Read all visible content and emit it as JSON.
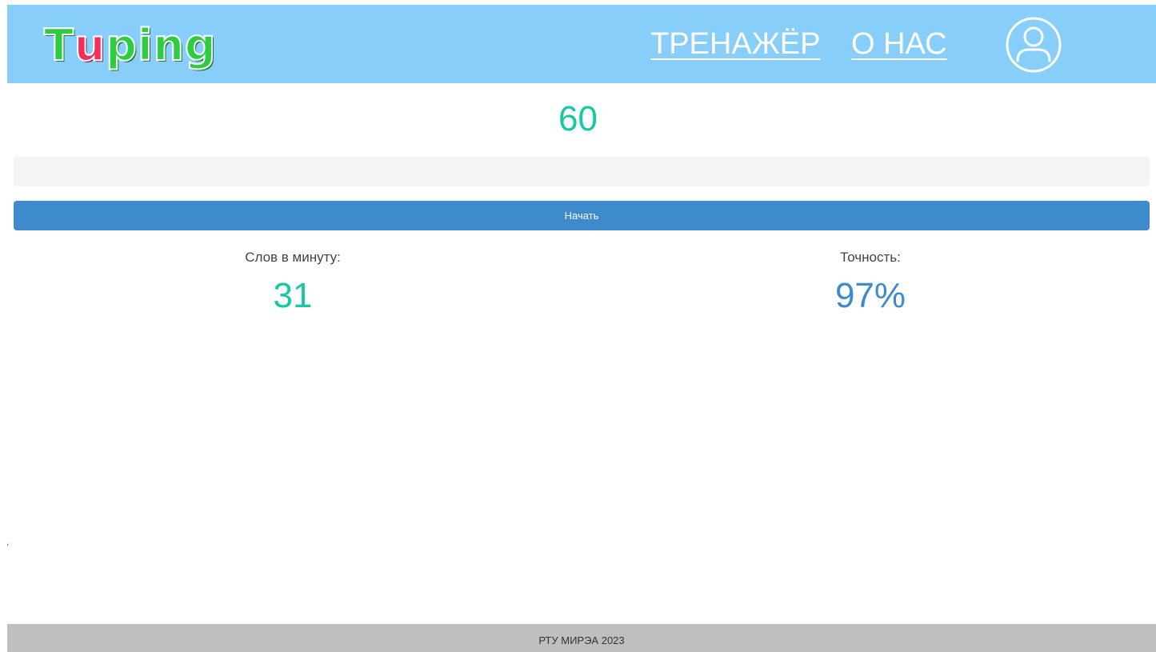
{
  "header": {
    "logo": {
      "part1": "T",
      "part2": "u",
      "part3": "ping"
    },
    "nav": {
      "trainer_label": "ТРЕНАЖЁР",
      "about_label": "О НАС"
    },
    "profile_icon": "user-circle-icon"
  },
  "main": {
    "timer": "60",
    "input": {
      "value": "",
      "placeholder": ""
    },
    "start_label": "Начать",
    "stats": {
      "wpm_label": "Слов в минуту:",
      "wpm_value": "31",
      "accuracy_label": "Точность:",
      "accuracy_value": "97%"
    },
    "stray_mark": ","
  },
  "footer": {
    "text": "РТУ МИРЭА 2023"
  },
  "colors": {
    "header_bg": "#87cefa",
    "accent_teal": "#17c9a3",
    "accent_blue": "#3d8bcd",
    "logo_green": "#2ecc40",
    "logo_red": "#f0305a",
    "footer_bg": "#bfbfbf"
  }
}
